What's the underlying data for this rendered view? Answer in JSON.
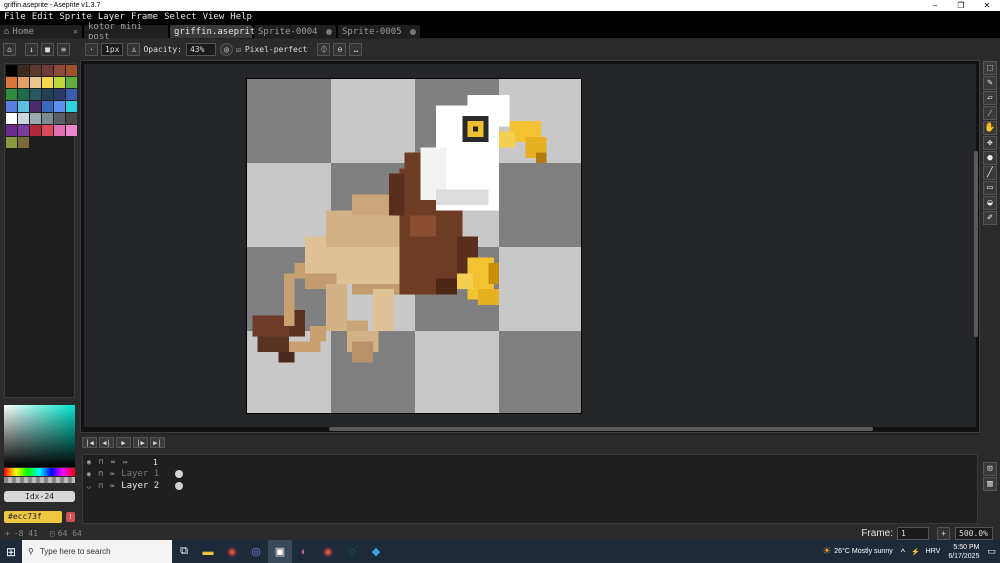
{
  "window": {
    "title": "griffin.aseprite - Aseprite v1.3.7"
  },
  "menu": [
    "File",
    "Edit",
    "Sprite",
    "Layer",
    "Frame",
    "Select",
    "View",
    "Help"
  ],
  "tabs": [
    {
      "label": "Home"
    },
    {
      "label": "kotor mini post"
    },
    {
      "label": "griffin.aseprite"
    },
    {
      "label": "Sprite-0004"
    },
    {
      "label": "Sprite-0005"
    }
  ],
  "context_bar": {
    "brush_size": "1px",
    "opacity_label": "Opacity:",
    "opacity_value": "43%",
    "pixel_perfect_label": "Pixel-perfect"
  },
  "palette_colors": [
    "#000000",
    "#3d2a1e",
    "#5a3a2e",
    "#6e3b3a",
    "#8c4a3a",
    "#a0522d",
    "#d9773b",
    "#e2a06a",
    "#e9c48f",
    "#f5d84a",
    "#c0d43c",
    "#5fae3f",
    "#2e8a3c",
    "#1f6b4a",
    "#24595f",
    "#234055",
    "#2c3a6a",
    "#3b5bb0",
    "#5a7ee0",
    "#5dc0e0",
    "#4a2a6a",
    "#3a6ac0",
    "#5a90f0",
    "#30d0e0",
    "#ffffff",
    "#cbd6e0",
    "#9aa8b0",
    "#7a8a92",
    "#5a6066",
    "#484848",
    "#6a2a8a",
    "#7a3aa0",
    "#b02a3a",
    "#d84a5a",
    "#e070b0",
    "#ee88cc",
    "#8a9a40",
    "#7a6a3a"
  ],
  "color": {
    "index_label": "Idx-24",
    "hex_label": "#ecc73f",
    "warning_glyph": "!"
  },
  "timeline": {
    "frame_number": "1",
    "layers": [
      {
        "name": "Layer 1"
      },
      {
        "name": "Layer 2"
      }
    ]
  },
  "status": {
    "cursor_pos": "-8 41",
    "sprite_size": "64 64",
    "frame_label": "Frame:",
    "frame_value": "1",
    "zoom": "500.0%"
  },
  "taskbar": {
    "search_placeholder": "Type here to search",
    "weather": "26°C  Mostly sunny",
    "language": "HRV",
    "time": "5:50 PM",
    "date": "6/17/2025"
  },
  "accent_color": "#ecc73f"
}
